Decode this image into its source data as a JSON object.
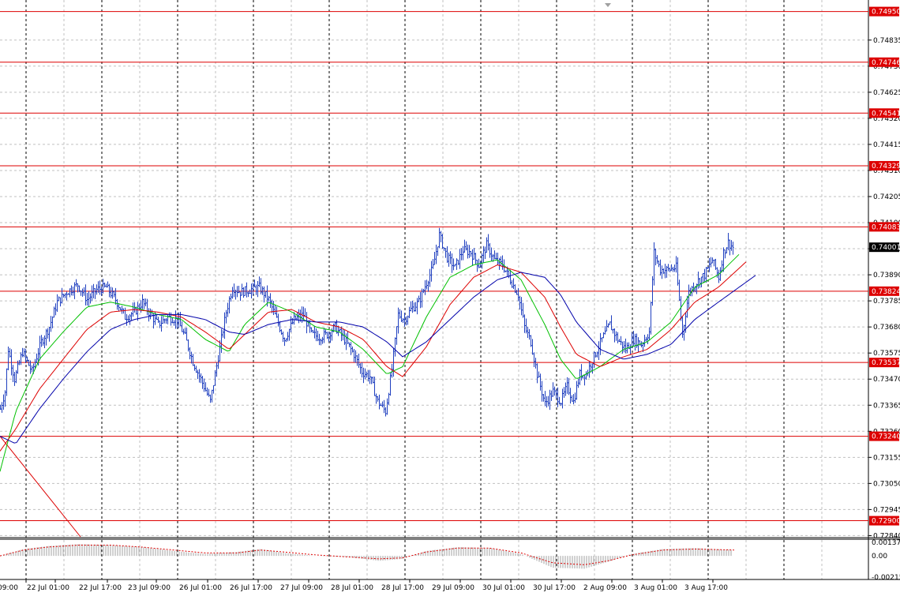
{
  "chart_data": [
    {
      "type": "line",
      "title": "",
      "instrument_note": "",
      "price_axis_ticks": [
        0.74835,
        0.7473,
        0.74625,
        0.7452,
        0.74415,
        0.7431,
        0.74205,
        0.741,
        0.73995,
        0.7389,
        0.73785,
        0.7368,
        0.73575,
        0.7347,
        0.73365,
        0.7326,
        0.73155,
        0.7305,
        0.72945,
        0.7284
      ],
      "ylim": [
        0.72835,
        0.7499
      ],
      "time_labels": [
        "09:00",
        "22 Jul 01:00",
        "22 Jul 17:00",
        "23 Jul 09:00",
        "26 Jul 01:00",
        "26 Jul 17:00",
        "27 Jul 09:00",
        "28 Jul 01:00",
        "28 Jul 17:00",
        "29 Jul 09:00",
        "30 Jul 01:00",
        "30 Jul 17:00",
        "2 Aug 09:00",
        "3 Aug 01:00",
        "3 Aug 17:00"
      ],
      "horizontal_levels": [
        0.7495,
        0.74746,
        0.74541,
        0.74329,
        0.74083,
        0.73824,
        0.73537,
        0.7324,
        0.729
      ],
      "current_price": 0.74001,
      "price_series": {
        "name": "",
        "color": "#1f3fbf",
        "anchors": [
          [
            0,
            0.7335
          ],
          [
            6,
            0.7342
          ],
          [
            10,
            0.7359
          ],
          [
            18,
            0.7347
          ],
          [
            28,
            0.7358
          ],
          [
            40,
            0.735
          ],
          [
            52,
            0.7362
          ],
          [
            62,
            0.7368
          ],
          [
            72,
            0.7378
          ],
          [
            84,
            0.7382
          ],
          [
            98,
            0.7385
          ],
          [
            110,
            0.7379
          ],
          [
            122,
            0.7383
          ],
          [
            134,
            0.7384
          ],
          [
            146,
            0.7379
          ],
          [
            158,
            0.7372
          ],
          [
            170,
            0.7374
          ],
          [
            180,
            0.7378
          ],
          [
            190,
            0.7373
          ],
          [
            200,
            0.7369
          ],
          [
            212,
            0.7372
          ],
          [
            224,
            0.7371
          ],
          [
            234,
            0.7364
          ],
          [
            244,
            0.7354
          ],
          [
            254,
            0.7347
          ],
          [
            266,
            0.7338
          ],
          [
            276,
            0.7356
          ],
          [
            286,
            0.7374
          ],
          [
            294,
            0.7384
          ],
          [
            304,
            0.7382
          ],
          [
            316,
            0.7383
          ],
          [
            328,
            0.7384
          ],
          [
            340,
            0.7379
          ],
          [
            350,
            0.7371
          ],
          [
            360,
            0.7363
          ],
          [
            372,
            0.7371
          ],
          [
            384,
            0.7373
          ],
          [
            394,
            0.7365
          ],
          [
            404,
            0.7364
          ],
          [
            414,
            0.7365
          ],
          [
            424,
            0.7368
          ],
          [
            436,
            0.7363
          ],
          [
            448,
            0.7357
          ],
          [
            458,
            0.735
          ],
          [
            468,
            0.7348
          ],
          [
            478,
            0.7338
          ],
          [
            488,
            0.7334
          ],
          [
            496,
            0.7351
          ],
          [
            504,
            0.7373
          ],
          [
            512,
            0.7371
          ],
          [
            520,
            0.7375
          ],
          [
            530,
            0.7378
          ],
          [
            540,
            0.7386
          ],
          [
            548,
            0.7392
          ],
          [
            556,
            0.7405
          ],
          [
            566,
            0.7396
          ],
          [
            576,
            0.7392
          ],
          [
            586,
            0.7399
          ],
          [
            596,
            0.7398
          ],
          [
            606,
            0.7393
          ],
          [
            616,
            0.7401
          ],
          [
            626,
            0.7395
          ],
          [
            636,
            0.7393
          ],
          [
            646,
            0.7387
          ],
          [
            656,
            0.7381
          ],
          [
            664,
            0.7368
          ],
          [
            672,
            0.7362
          ],
          [
            680,
            0.7349
          ],
          [
            690,
            0.7337
          ],
          [
            700,
            0.7342
          ],
          [
            710,
            0.7338
          ],
          [
            718,
            0.7344
          ],
          [
            726,
            0.7338
          ],
          [
            734,
            0.7349
          ],
          [
            742,
            0.7349
          ],
          [
            752,
            0.7356
          ],
          [
            762,
            0.7363
          ],
          [
            772,
            0.7369
          ],
          [
            782,
            0.7363
          ],
          [
            792,
            0.7359
          ],
          [
            802,
            0.7363
          ],
          [
            812,
            0.7361
          ],
          [
            822,
            0.7366
          ],
          [
            828,
            0.7398
          ],
          [
            836,
            0.7391
          ],
          [
            846,
            0.7391
          ],
          [
            856,
            0.7392
          ],
          [
            864,
            0.7365
          ],
          [
            872,
            0.7382
          ],
          [
            882,
            0.7386
          ],
          [
            892,
            0.7389
          ],
          [
            902,
            0.7395
          ],
          [
            910,
            0.7388
          ],
          [
            916,
            0.7398
          ],
          [
            922,
            0.7402
          ],
          [
            928,
            0.74
          ]
        ]
      },
      "moving_averages": [
        {
          "name": "",
          "color": "#00c000",
          "anchors": [
            [
              0,
              0.73098
            ],
            [
              20,
              0.7334
            ],
            [
              50,
              0.7355
            ],
            [
              80,
              0.7366
            ],
            [
              110,
              0.7376
            ],
            [
              140,
              0.7378
            ],
            [
              170,
              0.7376
            ],
            [
              200,
              0.7373
            ],
            [
              230,
              0.7371
            ],
            [
              260,
              0.7363
            ],
            [
              290,
              0.7358
            ],
            [
              310,
              0.7369
            ],
            [
              340,
              0.7378
            ],
            [
              370,
              0.7374
            ],
            [
              400,
              0.7368
            ],
            [
              430,
              0.7366
            ],
            [
              460,
              0.7359
            ],
            [
              490,
              0.7349
            ],
            [
              510,
              0.7352
            ],
            [
              540,
              0.7372
            ],
            [
              570,
              0.7388
            ],
            [
              600,
              0.7393
            ],
            [
              630,
              0.7395
            ],
            [
              660,
              0.7387
            ],
            [
              690,
              0.7369
            ],
            [
              710,
              0.7355
            ],
            [
              730,
              0.7347
            ],
            [
              760,
              0.7352
            ],
            [
              790,
              0.7359
            ],
            [
              820,
              0.7362
            ],
            [
              850,
              0.737
            ],
            [
              880,
              0.7384
            ],
            [
              910,
              0.7389
            ],
            [
              937,
              0.73975
            ]
          ]
        },
        {
          "name": "",
          "color": "#dd0000",
          "anchors": [
            [
              0,
              0.7318
            ],
            [
              20,
              0.7327
            ],
            [
              50,
              0.7343
            ],
            [
              80,
              0.7355
            ],
            [
              110,
              0.7367
            ],
            [
              140,
              0.7374
            ],
            [
              170,
              0.7375
            ],
            [
              200,
              0.7374
            ],
            [
              230,
              0.7372
            ],
            [
              260,
              0.7366
            ],
            [
              290,
              0.7359
            ],
            [
              310,
              0.7365
            ],
            [
              340,
              0.7374
            ],
            [
              370,
              0.7375
            ],
            [
              400,
              0.737
            ],
            [
              430,
              0.7368
            ],
            [
              460,
              0.7363
            ],
            [
              490,
              0.7352
            ],
            [
              510,
              0.7348
            ],
            [
              540,
              0.736
            ],
            [
              570,
              0.7377
            ],
            [
              600,
              0.7388
            ],
            [
              630,
              0.7393
            ],
            [
              660,
              0.739
            ],
            [
              690,
              0.738
            ],
            [
              710,
              0.7368
            ],
            [
              730,
              0.7357
            ],
            [
              760,
              0.7352
            ],
            [
              790,
              0.7356
            ],
            [
              820,
              0.7359
            ],
            [
              850,
              0.7367
            ],
            [
              880,
              0.7378
            ],
            [
              910,
              0.7384
            ],
            [
              946,
              0.73945
            ]
          ]
        },
        {
          "name": "",
          "color": "#0000aa",
          "anchors": [
            [
              0,
              0.7324
            ],
            [
              20,
              0.7321
            ],
            [
              50,
              0.7335
            ],
            [
              80,
              0.7347
            ],
            [
              110,
              0.7358
            ],
            [
              140,
              0.7367
            ],
            [
              170,
              0.7371
            ],
            [
              200,
              0.7373
            ],
            [
              230,
              0.7373
            ],
            [
              260,
              0.7371
            ],
            [
              290,
              0.7366
            ],
            [
              310,
              0.7365
            ],
            [
              340,
              0.7369
            ],
            [
              370,
              0.7371
            ],
            [
              400,
              0.737
            ],
            [
              430,
              0.737
            ],
            [
              460,
              0.7368
            ],
            [
              490,
              0.7362
            ],
            [
              510,
              0.7356
            ],
            [
              540,
              0.7362
            ],
            [
              570,
              0.7371
            ],
            [
              600,
              0.738
            ],
            [
              630,
              0.7387
            ],
            [
              660,
              0.739
            ],
            [
              690,
              0.7388
            ],
            [
              710,
              0.7381
            ],
            [
              730,
              0.737
            ],
            [
              760,
              0.7359
            ],
            [
              790,
              0.7355
            ],
            [
              820,
              0.7357
            ],
            [
              850,
              0.7361
            ],
            [
              880,
              0.7371
            ],
            [
              910,
              0.7378
            ],
            [
              958,
              0.7389
            ]
          ]
        }
      ],
      "trendline": {
        "color": "#dd0000",
        "from": [
          0,
          0.7324
        ],
        "to": [
          102,
          0.72835
        ]
      },
      "oscillator": {
        "ticks": [
          0.00137,
          0.0,
          -0.00215
        ],
        "signal_color": "#dd0000",
        "histogram_color": "#a0a0a0",
        "signal_anchors": [
          [
            0,
            0.0
          ],
          [
            30,
            0.0006
          ],
          [
            60,
            0.0009
          ],
          [
            100,
            0.0011
          ],
          [
            140,
            0.0011
          ],
          [
            180,
            0.0009
          ],
          [
            220,
            0.0006
          ],
          [
            260,
            0.0003
          ],
          [
            300,
            0.0003
          ],
          [
            330,
            0.0006
          ],
          [
            360,
            0.0004
          ],
          [
            400,
            0.0001
          ],
          [
            440,
            -0.0001
          ],
          [
            480,
            -0.0003
          ],
          [
            510,
            -0.0002
          ],
          [
            540,
            0.0004
          ],
          [
            580,
            0.0008
          ],
          [
            620,
            0.0008
          ],
          [
            660,
            0.0003
          ],
          [
            700,
            -0.0007
          ],
          [
            740,
            -0.0009
          ],
          [
            770,
            -0.0005
          ],
          [
            800,
            0.0001
          ],
          [
            840,
            0.0006
          ],
          [
            880,
            0.0007
          ],
          [
            930,
            0.0006
          ]
        ],
        "histogram_anchors": [
          [
            0,
            0.0
          ],
          [
            30,
            0.0007
          ],
          [
            60,
            0.001
          ],
          [
            100,
            0.0012
          ],
          [
            140,
            0.0011
          ],
          [
            180,
            0.0009
          ],
          [
            220,
            0.0005
          ],
          [
            260,
            0.0002
          ],
          [
            300,
            0.0004
          ],
          [
            330,
            0.0007
          ],
          [
            360,
            0.0003
          ],
          [
            400,
            0.0
          ],
          [
            440,
            -0.0001
          ],
          [
            480,
            -0.0005
          ],
          [
            510,
            -0.0003
          ],
          [
            540,
            0.0005
          ],
          [
            580,
            0.0009
          ],
          [
            620,
            0.0008
          ],
          [
            660,
            0.0002
          ],
          [
            700,
            -0.0012
          ],
          [
            740,
            -0.0013
          ],
          [
            770,
            -0.0006
          ],
          [
            800,
            0.0002
          ],
          [
            840,
            0.0007
          ],
          [
            880,
            0.0008
          ],
          [
            928,
            0.0006
          ]
        ]
      },
      "colors": {
        "grid": "#c0c0c0",
        "level_line": "#dd0000",
        "level_label_bg": "#dd0000",
        "current_label_bg": "#000000",
        "axis_text": "#000000"
      }
    }
  ]
}
